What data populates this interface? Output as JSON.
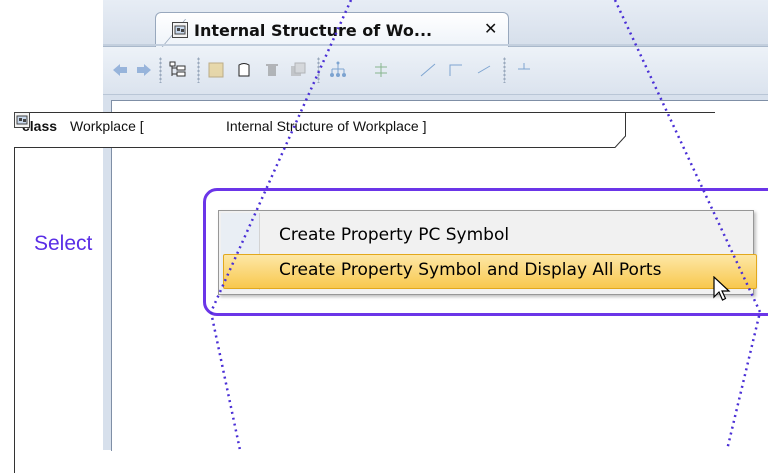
{
  "tab": {
    "title": "Internal Structure of Wo...",
    "close_icon": "✕"
  },
  "frame_header": {
    "keyword": "class",
    "name": "Workplace [",
    "reference": "Internal Structure of Workplace ]"
  },
  "context_menu": {
    "items": [
      {
        "label": "Create Property PC Symbol",
        "highlighted": false
      },
      {
        "label": "Create Property Symbol and Display All Ports",
        "highlighted": true
      }
    ]
  },
  "callout": {
    "label": "Select",
    "color": "#5a2ee6"
  },
  "colors": {
    "highlight": "#6b35e8",
    "menu_selected": "#f8c84e"
  },
  "icons": [
    "diagram-icon",
    "back-arrow-icon",
    "forward-arrow-icon",
    "tree-icon",
    "part-icon",
    "block-icon",
    "delete-icon",
    "copy-icon",
    "layout-icon",
    "connector-icon",
    "line-icon",
    "path-icon",
    "cursor-icon"
  ]
}
